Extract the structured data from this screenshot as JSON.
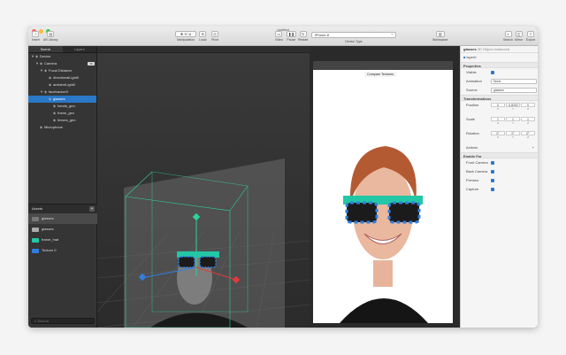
{
  "window": {
    "title": "Untitled"
  },
  "toolbar": {
    "left": [
      {
        "icon": "plus",
        "label": "Insert"
      },
      {
        "icon": "library",
        "label": "AR Library"
      }
    ],
    "mid": [
      {
        "icon": "move",
        "label": "Manipulation"
      },
      {
        "icon": "local",
        "label": "Local"
      },
      {
        "icon": "pivot",
        "label": "Pivot"
      }
    ],
    "video": [
      {
        "icon": "video",
        "label": "Video"
      },
      {
        "icon": "pause",
        "label": "Pause"
      },
      {
        "icon": "restart",
        "label": "Restart"
      }
    ],
    "device": {
      "value": "iPhone 8",
      "label": "Device Type"
    },
    "workspace": {
      "label": "Workspace"
    },
    "right": [
      {
        "icon": "search",
        "label": "Search"
      },
      {
        "icon": "mirror",
        "label": "Mirror"
      },
      {
        "icon": "export",
        "label": "Export"
      }
    ]
  },
  "scene_panel": {
    "tabs": [
      "Scene",
      "Layers"
    ],
    "tree": [
      {
        "label": "Device",
        "depth": 0,
        "caret": "▼",
        "icon": "device"
      },
      {
        "label": "Camera",
        "depth": 1,
        "caret": "▼",
        "icon": "camera",
        "badge": "3D"
      },
      {
        "label": "Focal Distance",
        "depth": 2,
        "caret": "▼",
        "icon": "focal"
      },
      {
        "label": "directionalLight0",
        "depth": 3,
        "caret": "",
        "icon": "light"
      },
      {
        "label": "ambientLight0",
        "depth": 3,
        "caret": "",
        "icon": "light"
      },
      {
        "label": "facetracker0",
        "depth": 2,
        "caret": "▼",
        "icon": "tracker"
      },
      {
        "label": "glasses",
        "depth": 3,
        "caret": "",
        "icon": "mesh",
        "selected": true
      },
      {
        "label": "hands_geo",
        "depth": 4,
        "caret": "",
        "icon": "mesh"
      },
      {
        "label": "frame_geo",
        "depth": 4,
        "caret": "",
        "icon": "mesh"
      },
      {
        "label": "lenses_geo",
        "depth": 4,
        "caret": "",
        "icon": "mesh"
      },
      {
        "label": "Microphone",
        "depth": 1,
        "caret": "",
        "icon": "mic"
      }
    ]
  },
  "assets_panel": {
    "title": "Assets",
    "items": [
      {
        "label": "glasses",
        "thumb": "#777"
      },
      {
        "label": "glasses",
        "thumb": "#aaa"
      },
      {
        "label": "frame_mat",
        "thumb": "#23c7a5"
      },
      {
        "label": "Texture 0",
        "thumb": "#2f7fe0"
      }
    ],
    "search_placeholder": "Search"
  },
  "simulator": {
    "compare_label": "Compare Textures"
  },
  "inspector": {
    "header_name": "glasses",
    "header_type": "3D Object Instanced",
    "layer_value": "layer0",
    "properties_title": "Properties",
    "visible_label": "Visible",
    "animation_label": "Animation",
    "animation_value": "None",
    "source_label": "Source",
    "source_value": "glasses",
    "transform_title": "Transformations",
    "position_label": "Position",
    "position": [
      "0",
      "-0.8202",
      "0"
    ],
    "scale_label": "Scale",
    "scale": [
      "1",
      "1",
      "1"
    ],
    "rotation_label": "Rotation",
    "rotation": [
      "0°",
      "0°",
      "0°"
    ],
    "axes": [
      "X",
      "Y",
      "Z"
    ],
    "actions_label": "Actions",
    "enable_title": "Enable For",
    "front_label": "Front Camera",
    "back_label": "Back Camera",
    "preview_label": "Preview",
    "capture_label": "Capture"
  },
  "colors": {
    "accent": "#2a78c8",
    "frame": "#23c7a5",
    "lens": "#1b1b1b",
    "bbox": "#2fd39a"
  }
}
